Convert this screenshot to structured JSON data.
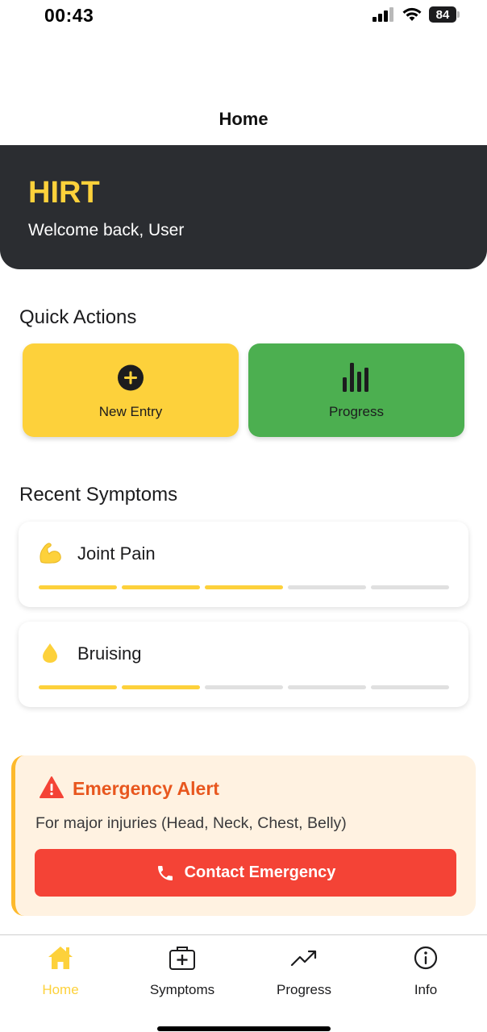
{
  "status_bar": {
    "time": "00:43",
    "battery": "84"
  },
  "nav": {
    "title": "Home"
  },
  "hero": {
    "title": "HIRT",
    "subtitle": "Welcome back, User"
  },
  "quick_actions": {
    "heading": "Quick Actions",
    "items": [
      {
        "label": "New Entry",
        "icon": "plus-circle-icon",
        "color": "#fdd13b"
      },
      {
        "label": "Progress",
        "icon": "bar-chart-icon",
        "color": "#4caf50"
      }
    ]
  },
  "recent_symptoms": {
    "heading": "Recent Symptoms",
    "items": [
      {
        "name": "Joint Pain",
        "icon": "flexed-arm-icon",
        "severity": 3,
        "max_severity": 5
      },
      {
        "name": "Bruising",
        "icon": "droplet-icon",
        "severity": 2,
        "max_severity": 5
      }
    ]
  },
  "emergency": {
    "title": "Emergency Alert",
    "text": "For major injuries (Head, Neck, Chest, Belly)",
    "button_label": "Contact Emergency",
    "accent": "#e8571e",
    "button_color": "#f44336"
  },
  "tab_bar": {
    "active": "Home",
    "items": [
      {
        "label": "Home",
        "icon": "home-icon"
      },
      {
        "label": "Symptoms",
        "icon": "medical-bag-icon"
      },
      {
        "label": "Progress",
        "icon": "trending-up-icon"
      },
      {
        "label": "Info",
        "icon": "info-icon"
      }
    ]
  },
  "colors": {
    "brand": "#fdd13b",
    "dark": "#2b2d31",
    "success": "#4caf50"
  }
}
